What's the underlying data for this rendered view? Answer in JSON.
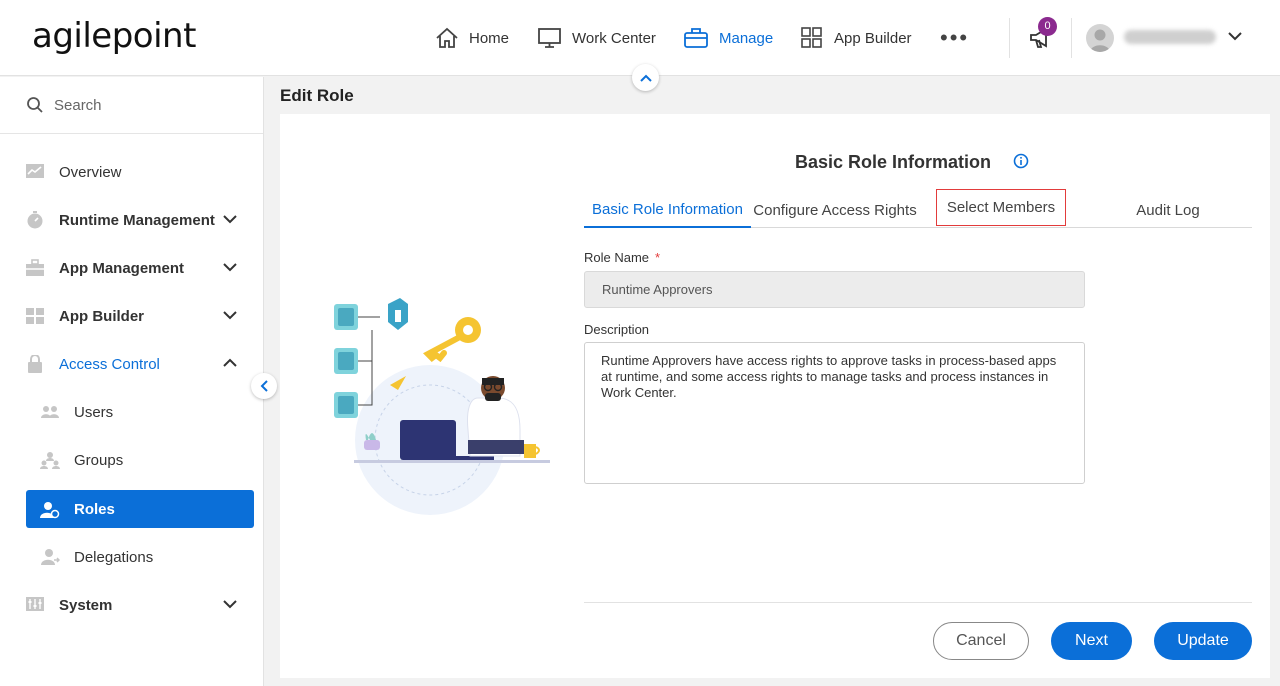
{
  "brand": {
    "logo_text": "agilepoint",
    "accent_color": "#0b6fd8"
  },
  "nav": {
    "items": [
      {
        "label": "Home",
        "icon": "home-icon"
      },
      {
        "label": "Work Center",
        "icon": "monitor-icon"
      },
      {
        "label": "Manage",
        "icon": "briefcase-icon",
        "active": true
      },
      {
        "label": "App Builder",
        "icon": "grid-icon"
      }
    ],
    "more_label": "•••",
    "notification_count": "0"
  },
  "sidebar": {
    "search_placeholder": "Search",
    "items": [
      {
        "label": "Overview",
        "icon": "chart-icon"
      },
      {
        "label": "Runtime Management",
        "icon": "stopwatch-icon",
        "expandable": true
      },
      {
        "label": "App Management",
        "icon": "toolbox-icon",
        "expandable": true
      },
      {
        "label": "App Builder",
        "icon": "grid-icon",
        "expandable": true
      },
      {
        "label": "Access Control",
        "icon": "lock-icon",
        "expanded": true
      },
      {
        "label": "Users",
        "icon": "users-icon"
      },
      {
        "label": "Groups",
        "icon": "groups-icon"
      },
      {
        "label": "Roles",
        "icon": "roles-icon",
        "selected": true
      },
      {
        "label": "Delegations",
        "icon": "delegations-icon"
      },
      {
        "label": "System",
        "icon": "system-icon",
        "expandable": true
      }
    ]
  },
  "page": {
    "title": "Edit Role",
    "section_title": "Basic Role Information",
    "tabs": [
      {
        "label": "Basic Role Information",
        "active": true
      },
      {
        "label": "Configure Access Rights"
      },
      {
        "label": "Select Members",
        "highlighted": true
      },
      {
        "label": "Audit Log"
      }
    ],
    "role_name_label": "Role Name",
    "required_mark": "*",
    "role_name_value": "Runtime Approvers",
    "description_label": "Description",
    "description_value": "Runtime Approvers have access rights to approve tasks in process-based apps at runtime, and some access rights to manage tasks and process instances in Work Center."
  },
  "buttons": {
    "cancel": "Cancel",
    "next": "Next",
    "update": "Update"
  }
}
